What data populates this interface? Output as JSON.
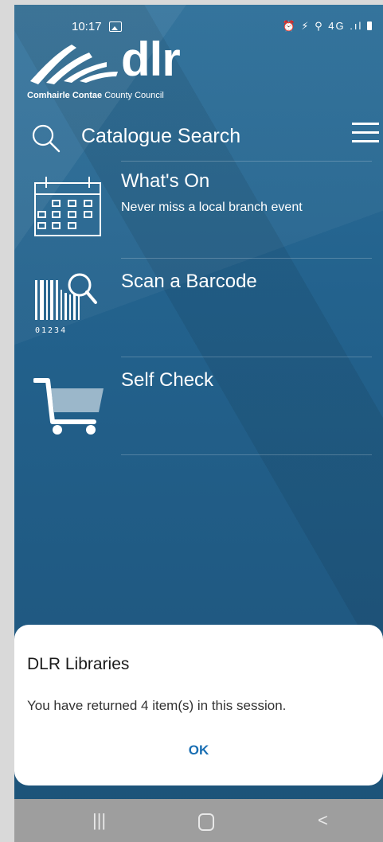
{
  "status_bar": {
    "time": "10:17",
    "right_icons": "⏰ ⚡ ⚲ 4G .ıl"
  },
  "logo": {
    "word": "dlr",
    "council_bold": "Comhairle Contae",
    "council_rest": "County Council"
  },
  "search": {
    "label": "Catalogue Search"
  },
  "menu": [
    {
      "title": "What's On",
      "subtitle": "Never miss a local branch event",
      "icon": "calendar-icon"
    },
    {
      "title": "Scan a Barcode",
      "subtitle": "",
      "icon": "barcode-icon",
      "barcode_digits": "01234"
    },
    {
      "title": "Self Check",
      "subtitle": "",
      "icon": "cart-icon"
    }
  ],
  "dialog": {
    "title": "DLR Libraries",
    "message": "You have returned 4 item(s) in this session.",
    "ok_label": "OK"
  },
  "nav": {
    "recents": "|||",
    "back": "<"
  },
  "colors": {
    "background": "#23628d",
    "accent": "#1a6fb3",
    "nav_bar": "#9e9e9e"
  }
}
